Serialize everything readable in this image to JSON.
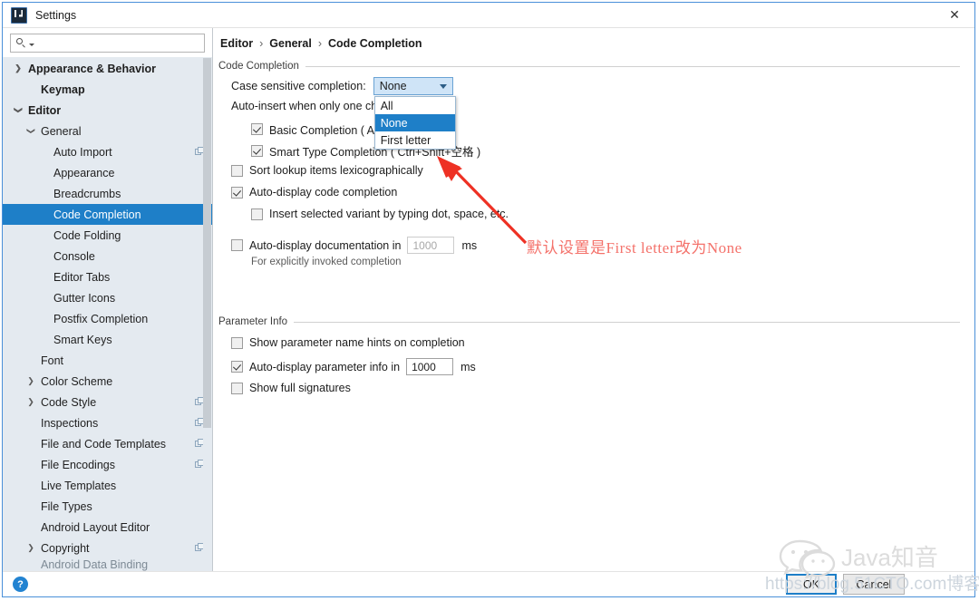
{
  "window": {
    "title": "Settings",
    "app_icon": "intellij-idea-icon",
    "close_label": "✕"
  },
  "search": {
    "value": "",
    "placeholder": "",
    "icon": "search-icon"
  },
  "sidebar": {
    "items": [
      {
        "label": "Appearance & Behavior",
        "indent": 0,
        "twisty": "collapsed",
        "bold": true,
        "copy": false,
        "selected": false
      },
      {
        "label": "Keymap",
        "indent": 1,
        "twisty": "none",
        "bold": true,
        "copy": false,
        "selected": false
      },
      {
        "label": "Editor",
        "indent": 0,
        "twisty": "expanded",
        "bold": true,
        "copy": false,
        "selected": false
      },
      {
        "label": "General",
        "indent": 1,
        "twisty": "expanded",
        "bold": false,
        "copy": false,
        "selected": false
      },
      {
        "label": "Auto Import",
        "indent": 2,
        "twisty": "none",
        "bold": false,
        "copy": true,
        "selected": false
      },
      {
        "label": "Appearance",
        "indent": 2,
        "twisty": "none",
        "bold": false,
        "copy": false,
        "selected": false
      },
      {
        "label": "Breadcrumbs",
        "indent": 2,
        "twisty": "none",
        "bold": false,
        "copy": false,
        "selected": false
      },
      {
        "label": "Code Completion",
        "indent": 2,
        "twisty": "none",
        "bold": false,
        "copy": false,
        "selected": true
      },
      {
        "label": "Code Folding",
        "indent": 2,
        "twisty": "none",
        "bold": false,
        "copy": false,
        "selected": false
      },
      {
        "label": "Console",
        "indent": 2,
        "twisty": "none",
        "bold": false,
        "copy": false,
        "selected": false
      },
      {
        "label": "Editor Tabs",
        "indent": 2,
        "twisty": "none",
        "bold": false,
        "copy": false,
        "selected": false
      },
      {
        "label": "Gutter Icons",
        "indent": 2,
        "twisty": "none",
        "bold": false,
        "copy": false,
        "selected": false
      },
      {
        "label": "Postfix Completion",
        "indent": 2,
        "twisty": "none",
        "bold": false,
        "copy": false,
        "selected": false
      },
      {
        "label": "Smart Keys",
        "indent": 2,
        "twisty": "none",
        "bold": false,
        "copy": false,
        "selected": false
      },
      {
        "label": "Font",
        "indent": 1,
        "twisty": "none",
        "bold": false,
        "copy": false,
        "selected": false
      },
      {
        "label": "Color Scheme",
        "indent": 1,
        "twisty": "collapsed",
        "bold": false,
        "copy": false,
        "selected": false
      },
      {
        "label": "Code Style",
        "indent": 1,
        "twisty": "collapsed",
        "bold": false,
        "copy": true,
        "selected": false
      },
      {
        "label": "Inspections",
        "indent": 1,
        "twisty": "none",
        "bold": false,
        "copy": true,
        "selected": false
      },
      {
        "label": "File and Code Templates",
        "indent": 1,
        "twisty": "none",
        "bold": false,
        "copy": true,
        "selected": false
      },
      {
        "label": "File Encodings",
        "indent": 1,
        "twisty": "none",
        "bold": false,
        "copy": true,
        "selected": false
      },
      {
        "label": "Live Templates",
        "indent": 1,
        "twisty": "none",
        "bold": false,
        "copy": false,
        "selected": false
      },
      {
        "label": "File Types",
        "indent": 1,
        "twisty": "none",
        "bold": false,
        "copy": false,
        "selected": false
      },
      {
        "label": "Android Layout Editor",
        "indent": 1,
        "twisty": "none",
        "bold": false,
        "copy": false,
        "selected": false
      },
      {
        "label": "Copyright",
        "indent": 1,
        "twisty": "collapsed",
        "bold": false,
        "copy": true,
        "selected": false
      },
      {
        "label": "Android Data Binding",
        "indent": 1,
        "twisty": "none",
        "bold": false,
        "copy": false,
        "selected": false,
        "clipped": true
      }
    ]
  },
  "breadcrumb": {
    "part1": "Editor",
    "sep1": "›",
    "part2": "General",
    "sep2": "›",
    "part3": "Code Completion"
  },
  "code_completion": {
    "group_title": "Code Completion",
    "case_sensitive_label": "Case sensitive completion:",
    "case_sensitive_value": "None",
    "case_sensitive_options": [
      "All",
      "None",
      "First letter"
    ],
    "case_sensitive_highlighted": "None",
    "auto_insert_label": "Auto-insert when only one choice on:",
    "basic_completion": "Basic Completion ( Alt+空格 )",
    "smart_type_completion": "Smart Type Completion ( Ctrl+Shift+空格 )",
    "sort_lookup": "Sort lookup items lexicographically",
    "auto_display_code": "Auto-display code completion",
    "insert_selected_variant": "Insert selected variant by typing dot, space, etc.",
    "auto_display_doc": "Auto-display documentation in",
    "auto_display_doc_value": "1000",
    "auto_display_doc_unit": "ms",
    "auto_display_doc_hint": "For explicitly invoked completion"
  },
  "parameter_info": {
    "group_title": "Parameter Info",
    "show_hints": "Show parameter name hints on completion",
    "auto_display_label": "Auto-display parameter info in",
    "auto_display_value": "1000",
    "auto_display_unit": "ms",
    "show_full_signatures": "Show full signatures"
  },
  "annotation": {
    "text": "默认设置是First letter改为None",
    "color": "#f4726b",
    "arrow": "red-arrow-pointer"
  },
  "footer": {
    "help_glyph": "?",
    "ok_label": "OK",
    "cancel_label": "Cancel"
  },
  "watermark": {
    "brand": "Java知音",
    "url": "https://blog.51CTO.com博客",
    "logo": "wechat-icon"
  },
  "colors": {
    "selection_blue": "#1e7fc8",
    "sidebar_bg": "#e4eaf0",
    "accent_border": "#4a90d9",
    "annotation_red": "#f4726b"
  }
}
